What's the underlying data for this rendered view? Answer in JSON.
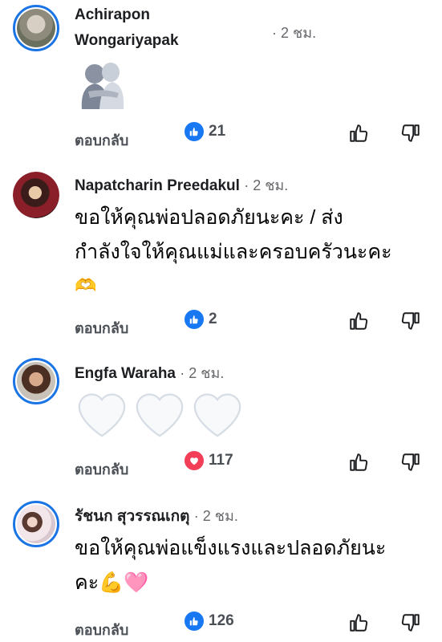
{
  "comments": [
    {
      "name_line1": "Achirapon",
      "name_line2": "Wongariyapak",
      "time": "· 2 ชม.",
      "sticker": "hug-sticker",
      "reply": "ตอบกลับ",
      "reaction": "like",
      "count": "21"
    },
    {
      "name": "Napatcharin Preedakul",
      "time": "· 2 ชม.",
      "text_line1": "ขอให้คุณพ่อปลอดภัยนะคะ  / ส่ง",
      "text_line2": "กำลังใจให้คุณแม่และครอบครัวนะคะ",
      "emoji": "🫶",
      "reply": "ตอบกลับ",
      "reaction": "like",
      "count": "2"
    },
    {
      "name": "Engfa Waraha",
      "time": "· 2 ชม.",
      "emoji": "🤍🤍🤍",
      "reply": "ตอบกลับ",
      "reaction": "love",
      "count": "117"
    },
    {
      "name": "รัชนก สุวรรณเกตุ",
      "time": "· 2 ชม.",
      "text_line1": "ขอให้คุณพ่อแข็งแรงและปลอดภัยนะ",
      "text_line2": "คะ",
      "emoji": "💪🩷",
      "reply": "ตอบกลับ",
      "reaction": "like",
      "count": "126"
    }
  ],
  "icons": {
    "up": "thumbs-up-outline-icon",
    "down": "thumbs-down-outline-icon"
  },
  "colors": {
    "like": "#1877f2",
    "love": "#f33e58",
    "avatar_ring": "#1b74e4"
  }
}
